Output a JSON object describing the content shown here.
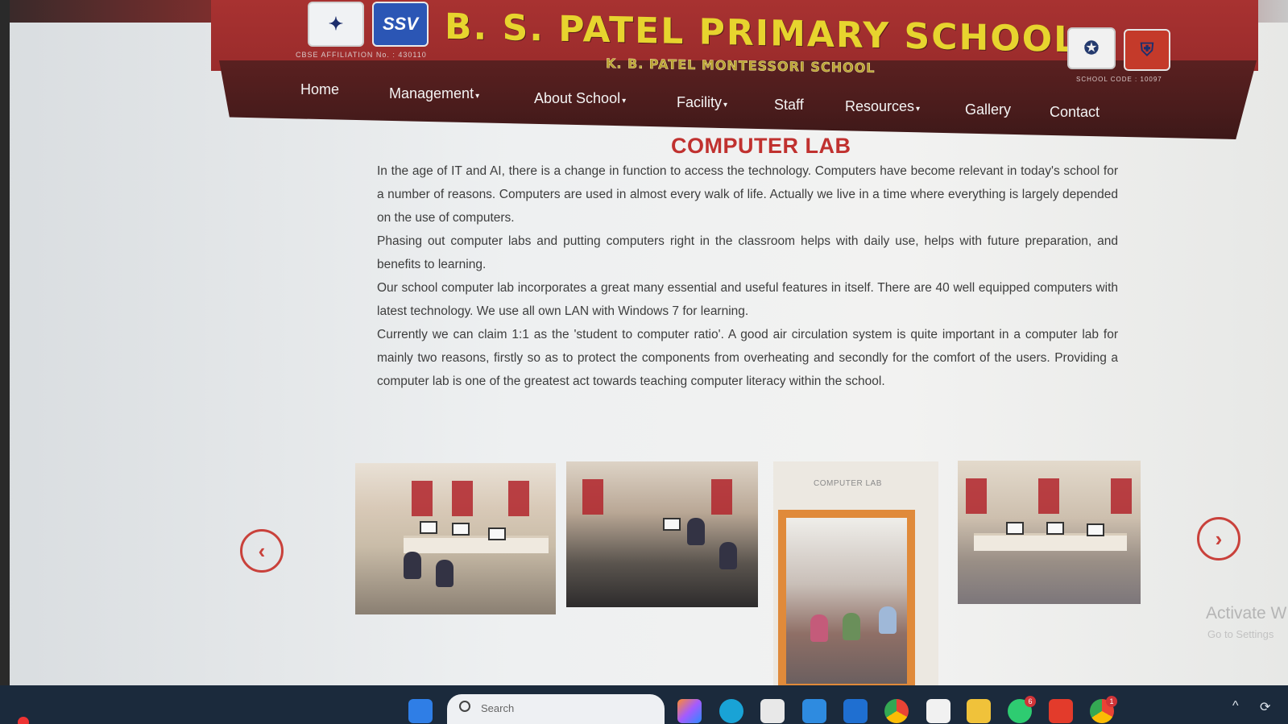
{
  "header": {
    "school_name": "B. S. PATEL PRIMARY SCHOOL",
    "subtitle": "K. B. PATEL MONTESSORI SCHOOL",
    "affiliation": "CBSE AFFILIATION No. : 430110",
    "school_code": "SCHOOL CODE : 10097",
    "logos": [
      "emblem-logo",
      "ssv-logo",
      "crest-logo",
      "shield-logo"
    ],
    "logo2_text": "SSV"
  },
  "nav": {
    "home": "Home",
    "management": "Management",
    "about": "About School",
    "facility": "Facility",
    "staff": "Staff",
    "resources": "Resources",
    "gallery": "Gallery",
    "contact": "Contact",
    "caret": "▾"
  },
  "page": {
    "heading": "COMPUTER LAB",
    "paragraphs": [
      "In the age of IT and AI, there is a change in function to access the technology. Computers have become relevant in today's school for a number of reasons. Computers are used in almost every walk of life. Actually we live in a time where everything is largely depended on the use of computers.",
      "Phasing out computer labs and putting computers right in the classroom helps with daily use, helps with future preparation, and benefits to learning.",
      "Our school computer lab incorporates a great many essential and useful features in itself. There are 40 well equipped computers with latest technology. We use all own LAN with Windows 7 for learning.",
      "Currently we can claim 1:1 as the 'student to computer ratio'. A good air circulation system is quite important in a computer lab for mainly two reasons, firstly so as to protect the components from overheating and secondly for the comfort of the users. Providing a computer lab is one of the greatest act towards teaching computer literacy within the school."
    ]
  },
  "carousel": {
    "prev_icon": "‹",
    "next_icon": "›",
    "photo3_sign": "COMPUTER LAB"
  },
  "windows_watermark": {
    "title": "Activate W",
    "sub": "Go to Settings"
  },
  "taskbar": {
    "search_placeholder": "Search",
    "whatsapp_badge": "6",
    "chrome_badge": "1",
    "tray_chevron": "^"
  },
  "colors": {
    "header_red": "#a83231",
    "nav_brown": "#4a1c1c",
    "title_yellow": "#e7d42e",
    "heading_red": "#c0312f"
  }
}
